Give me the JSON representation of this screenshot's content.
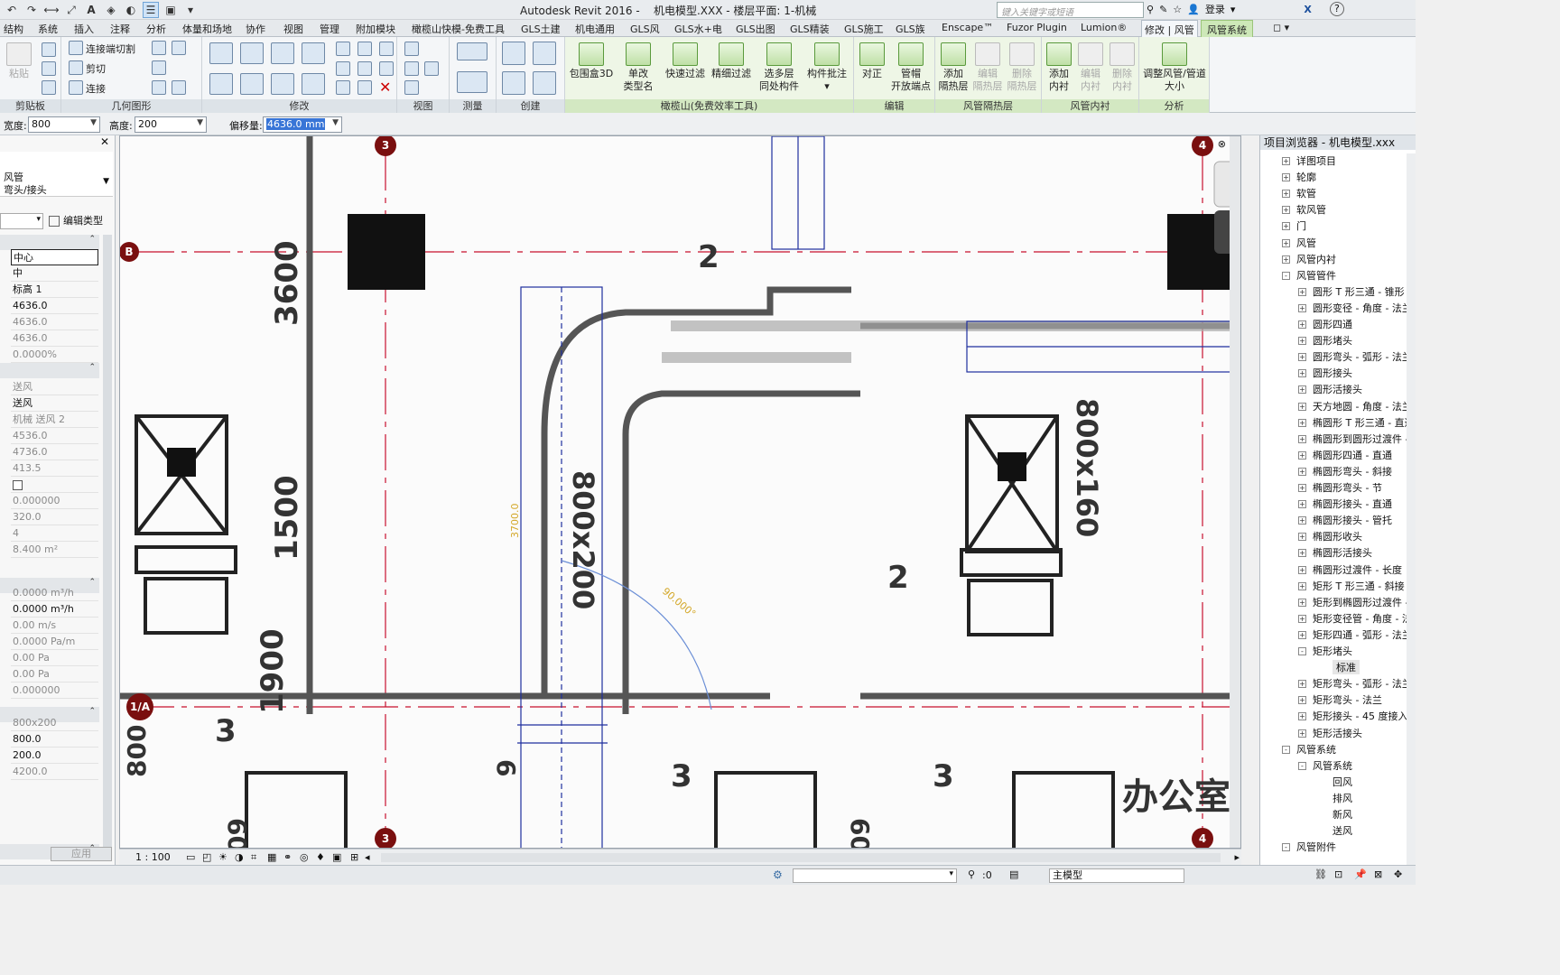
{
  "title": {
    "app": "Autodesk Revit 2016 -",
    "document": "机电模型.XXX - 楼层平面: 1-机械",
    "search_placeholder": "键入关键字或短语",
    "login": "登录",
    "help": "?"
  },
  "tabs": [
    "结构",
    "系统",
    "插入",
    "注释",
    "分析",
    "体量和场地",
    "协作",
    "视图",
    "管理",
    "附加模块",
    "橄榄山快模-免费工具",
    "GLS土建",
    "机电通用",
    "GLS风",
    "GLS水+电",
    "GLS出图",
    "GLS精装",
    "GLS施工",
    "GLS族",
    "Enscape™",
    "Fuzor Plugin",
    "Lumion®",
    "修改 | 风管",
    "风管系统"
  ],
  "ribbon": {
    "clipboard": {
      "paste": "粘贴",
      "label": "剪贴板"
    },
    "geometry": {
      "join_cut": "连接端切割",
      "cut": "剪切",
      "join": "连接",
      "label": "几何图形"
    },
    "modify": {
      "label": "修改"
    },
    "view": {
      "label": "视图"
    },
    "measure": {
      "label": "测量"
    },
    "create": {
      "label": "创建"
    },
    "olive": {
      "box3d": "包围盒3D",
      "rename_1": "单改",
      "rename_2": "类型名",
      "quick_filter": "快速过滤",
      "fine_filter": "精细过滤",
      "multi_1": "选多层",
      "multi_2": "同处构件",
      "batch_1": "构件批注",
      "label": "橄榄山(免费效率工具)"
    },
    "edit": {
      "align": "对正",
      "cap_1": "管帽",
      "cap_2": "开放端点",
      "label": "编辑"
    },
    "insulation": {
      "add_1": "添加",
      "add_2": "隔热层",
      "edit_1": "编辑",
      "edit_2": "隔热层",
      "del_1": "删除",
      "del_2": "隔热层",
      "label": "风管隔热层"
    },
    "lining": {
      "add_1": "添加",
      "add_2": "内衬",
      "edit_1": "编辑",
      "edit_2": "内衬",
      "del_1": "删除",
      "del_2": "内衬",
      "label": "风管内衬"
    },
    "analysis": {
      "resize_1": "调整风管/管道",
      "resize_2": "大小",
      "label": "分析"
    }
  },
  "options": {
    "width_label": "宽度:",
    "width_value": "800",
    "height_label": "高度:",
    "height_value": "200",
    "offset_label": "偏移量:",
    "offset_value": "4636.0 mm"
  },
  "properties": {
    "type_line1": "风管",
    "type_line2": "弯头/接头",
    "edit_type": "编辑类型",
    "apply": "应用",
    "rows": [
      "中心",
      "中",
      "标高 1",
      "4636.0",
      "4636.0",
      "4636.0",
      "0.0000%",
      "送风",
      "送风",
      "机械 送风 2",
      "4536.0",
      "4736.0",
      "413.5",
      "",
      "0.000000",
      "320.0",
      "4",
      "8.400 m²",
      "0.0000 m³/h",
      "0.0000 m³/h",
      "0.00 m/s",
      "0.0000 Pa/m",
      "0.00 Pa",
      "0.00 Pa",
      "0.000000",
      "800x200",
      "800.0",
      "200.0",
      "4200.0"
    ]
  },
  "canvas": {
    "grid_3": "3",
    "grid_4": "4",
    "grid_B": "B",
    "grid_1A": "1/A",
    "dim_3600": "3600",
    "dim_1500": "1500",
    "dim_1900": "1900",
    "dim_800": "800",
    "dim_60": "60",
    "duct_size_v": "800x200",
    "duct_size_r": "800x160",
    "temp_dim": "3700.0",
    "angle": "90.000°",
    "tag_2": "2",
    "tag_3": "3",
    "tag_6": "6",
    "room_office": "办公室"
  },
  "viewbar": {
    "scale": "1 : 100"
  },
  "browser": {
    "title": "项目浏览器 - 机电模型.xxx",
    "nodes": [
      {
        "label": "详图项目",
        "level": 1,
        "exp": "+"
      },
      {
        "label": "轮廓",
        "level": 1,
        "exp": "+"
      },
      {
        "label": "软管",
        "level": 1,
        "exp": "+"
      },
      {
        "label": "软风管",
        "level": 1,
        "exp": "+"
      },
      {
        "label": "门",
        "level": 1,
        "exp": "+"
      },
      {
        "label": "风管",
        "level": 1,
        "exp": "+"
      },
      {
        "label": "风管内衬",
        "level": 1,
        "exp": "+"
      },
      {
        "label": "风管管件",
        "level": 1,
        "exp": "-"
      },
      {
        "label": "圆形 T 形三通 - 锥形 -",
        "level": 2,
        "exp": "+"
      },
      {
        "label": "圆形变径 - 角度 - 法兰",
        "level": 2,
        "exp": "+"
      },
      {
        "label": "圆形四通",
        "level": 2,
        "exp": "+"
      },
      {
        "label": "圆形堵头",
        "level": 2,
        "exp": "+"
      },
      {
        "label": "圆形弯头 - 弧形 - 法兰",
        "level": 2,
        "exp": "+"
      },
      {
        "label": "圆形接头",
        "level": 2,
        "exp": "+"
      },
      {
        "label": "圆形活接头",
        "level": 2,
        "exp": "+"
      },
      {
        "label": "天方地圆 - 角度 - 法兰",
        "level": 2,
        "exp": "+"
      },
      {
        "label": "椭圆形 T 形三通 - 直通",
        "level": 2,
        "exp": "+"
      },
      {
        "label": "椭圆形到圆形过渡件 -",
        "level": 2,
        "exp": "+"
      },
      {
        "label": "椭圆形四通 - 直通",
        "level": 2,
        "exp": "+"
      },
      {
        "label": "椭圆形弯头 - 斜接",
        "level": 2,
        "exp": "+"
      },
      {
        "label": "椭圆形弯头 - 节",
        "level": 2,
        "exp": "+"
      },
      {
        "label": "椭圆形接头 - 直通",
        "level": 2,
        "exp": "+"
      },
      {
        "label": "椭圆形接头 - 管托",
        "level": 2,
        "exp": "+"
      },
      {
        "label": "椭圆形收头",
        "level": 2,
        "exp": "+"
      },
      {
        "label": "椭圆形活接头",
        "level": 2,
        "exp": "+"
      },
      {
        "label": "椭圆形过渡件 - 长度",
        "level": 2,
        "exp": "+"
      },
      {
        "label": "矩形 T 形三通 - 斜接 -",
        "level": 2,
        "exp": "+"
      },
      {
        "label": "矩形到椭圆形过渡件 -",
        "level": 2,
        "exp": "+"
      },
      {
        "label": "矩形变径管 - 角度 - 法",
        "level": 2,
        "exp": "+"
      },
      {
        "label": "矩形四通 - 弧形 - 法兰",
        "level": 2,
        "exp": "+"
      },
      {
        "label": "矩形堵头",
        "level": 2,
        "exp": "-"
      },
      {
        "label": "标准",
        "level": 3,
        "exp": "",
        "hl": true
      },
      {
        "label": "矩形弯头 - 弧形 - 法兰",
        "level": 2,
        "exp": "+"
      },
      {
        "label": "矩形弯头 - 法兰",
        "level": 2,
        "exp": "+"
      },
      {
        "label": "矩形接头 - 45 度接入 -",
        "level": 2,
        "exp": "+"
      },
      {
        "label": "矩形活接头",
        "level": 2,
        "exp": "+"
      },
      {
        "label": "风管系统",
        "level": 1,
        "exp": "-"
      },
      {
        "label": "风管系统",
        "level": 2,
        "exp": "-"
      },
      {
        "label": "回风",
        "level": 3,
        "exp": ""
      },
      {
        "label": "排风",
        "level": 3,
        "exp": ""
      },
      {
        "label": "新风",
        "level": 3,
        "exp": ""
      },
      {
        "label": "送风",
        "level": 3,
        "exp": ""
      },
      {
        "label": "风管附件",
        "level": 1,
        "exp": "-"
      }
    ]
  },
  "status": {
    "zero": ":0",
    "model": "主模型"
  },
  "colors": {
    "grid_red": "#c8102e",
    "duct_blue": "#1f2f9e",
    "dim_yellow": "#d4a82a",
    "context_green": "#cde8b8"
  }
}
